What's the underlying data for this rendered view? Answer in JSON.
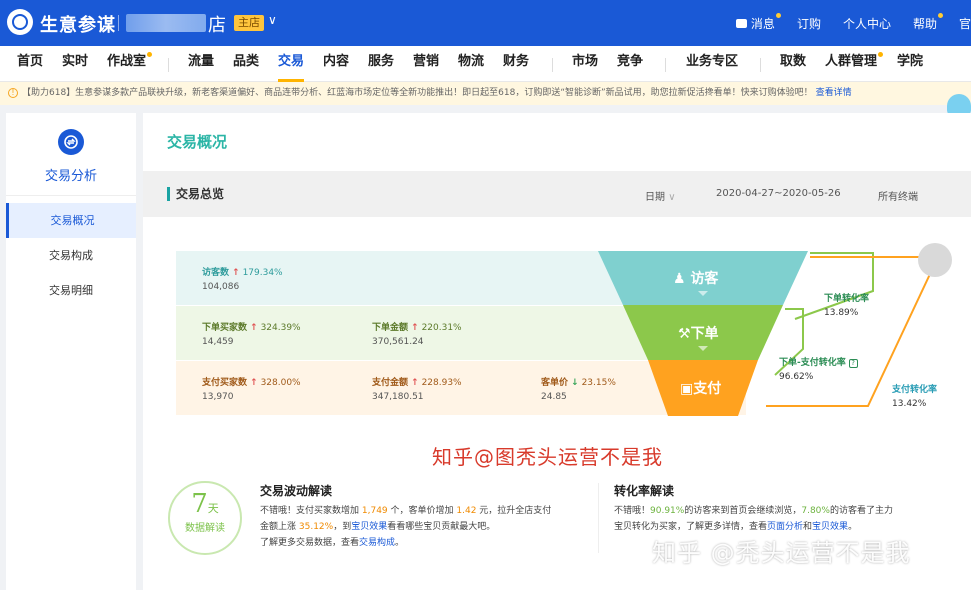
{
  "topbar": {
    "brand": "生意参谋",
    "shop_name_tail": "店",
    "shop_badge": "主店",
    "links": [
      "消息",
      "订购",
      "个人中心",
      "帮助",
      "官"
    ]
  },
  "nav": [
    "首页",
    "实时",
    "作战室",
    "流量",
    "品类",
    "交易",
    "内容",
    "服务",
    "营销",
    "物流",
    "财务",
    "市场",
    "竞争",
    "业务专区",
    "取数",
    "人群管理",
    "学院"
  ],
  "notice": {
    "text": "【助力618】生意参谋多款产品联袂升级，新老客渠道偏好、商品连带分析、红蓝海市场定位等全新功能推出！即日起至618，订购即送“智能诊断”新品试用，助您拉新促活搀看单！快来订购体验吧！",
    "link": "查看详情"
  },
  "sidebar": {
    "title": "交易分析",
    "items": [
      "交易概况",
      "交易构成",
      "交易明细"
    ]
  },
  "main": {
    "title": "交易概况",
    "section": "交易总览",
    "filter_date_label": "日期",
    "date_range": "2020-04-27~2020-05-26",
    "terminal": "所有终端"
  },
  "funnel": {
    "visitors": {
      "label": "访客数",
      "pct": "179.34%",
      "value": "104,086"
    },
    "order_buyers": {
      "label": "下单买家数",
      "pct": "324.39%",
      "value": "14,459"
    },
    "order_amount": {
      "label": "下单金额",
      "pct": "220.31%",
      "value": "370,561.24"
    },
    "pay_buyers": {
      "label": "支付买家数",
      "pct": "328.00%",
      "value": "13,970"
    },
    "pay_amount": {
      "label": "支付金额",
      "pct": "228.93%",
      "value": "347,180.51"
    },
    "avg_price": {
      "label": "客单价",
      "pct": "23.15%",
      "value": "24.85"
    },
    "stage_labels": [
      "访客",
      "下单",
      "支付"
    ],
    "order_conv": {
      "label": "下单转化率",
      "value": "13.89%"
    },
    "order_pay_conv": {
      "label": "下单-支付转化率",
      "value": "96.62%"
    },
    "pay_conv": {
      "label": "支付转化率",
      "value": "13.42%"
    }
  },
  "watermark_red": "知乎@图秃头运营不是我",
  "badge": {
    "num": "7",
    "unit": "天",
    "caption": "数据解读"
  },
  "fluctuation": {
    "title": "交易波动解读",
    "line1_a": "不错哦！支付买家数增加 ",
    "line1_b": "1,749",
    "line1_c": " 个，客单价增加 ",
    "line1_d": "1.42",
    "line1_e": " 元，拉升全店支付",
    "line2_a": "金额上涨 ",
    "line2_b": "35.12%",
    "line2_c": "，到",
    "line2_d": "宝贝效果",
    "line2_e": "看看哪些宝贝贡献最大吧。",
    "line3_a": "了解更多交易数据，查看",
    "line3_b": "交易构成",
    "line3_c": "。"
  },
  "conversion": {
    "title": "转化率解读",
    "line1_a": "不错哦！",
    "line1_b": "90.91%",
    "line1_c": "的访客来到首页会继续浏览，",
    "line1_d": "7.80%",
    "line1_e": "的访客看了主力",
    "line2_a": "宝贝转化为买家，了解更多详情，查看",
    "line2_b": "页面分析",
    "line2_c": "和",
    "line2_d": "宝贝效果",
    "line2_e": "。"
  },
  "watermark_bottom": "知乎 @秃头运营不是我",
  "colors": {
    "primary": "#1a59d6",
    "teal": "#7fd0cf",
    "green": "#8cc84b",
    "orange": "#ffa21f"
  }
}
